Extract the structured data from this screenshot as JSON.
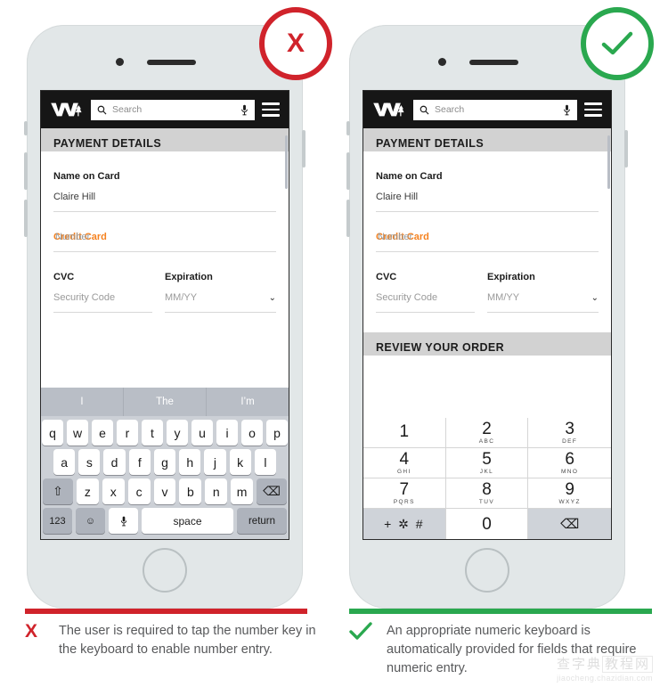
{
  "badges": {
    "bad": {
      "name": "x-mark",
      "glyph": "X",
      "color": "#d0232b"
    },
    "good": {
      "name": "check-mark",
      "glyph": "✓",
      "color": "#2aa84f"
    }
  },
  "appbar": {
    "logo_alt": "M logo",
    "search_placeholder": "Search",
    "search_icon": "search-icon",
    "mic_icon": "microphone-icon",
    "menu_icon": "hamburger-menu-icon"
  },
  "screen_left": {
    "section_title": "PAYMENT DETAILS",
    "fields": {
      "name_label": "Name on Card",
      "name_value": "Claire Hill",
      "card_label": "Credit Card",
      "card_placeholder": "Number",
      "cvc_label": "CVC",
      "cvc_placeholder": "Security  Code",
      "exp_label": "Expiration",
      "exp_placeholder": "MM/YY",
      "exp_chevron": "⌄"
    }
  },
  "screen_right": {
    "section_title": "PAYMENT DETAILS",
    "review_title": "REVIEW YOUR ORDER",
    "fields": {
      "name_label": "Name on Card",
      "name_value": "Claire Hill",
      "card_label": "Credit Card",
      "card_placeholder": "Number",
      "cvc_label": "CVC",
      "cvc_placeholder": "Security  Code",
      "exp_label": "Expiration",
      "exp_placeholder": "MM/YY",
      "exp_chevron": "⌄"
    }
  },
  "keyboard_alpha": {
    "suggestions": [
      "I",
      "The",
      "I’m"
    ],
    "row1": [
      "q",
      "w",
      "e",
      "r",
      "t",
      "y",
      "u",
      "i",
      "o",
      "p"
    ],
    "row2": [
      "a",
      "s",
      "d",
      "f",
      "g",
      "h",
      "j",
      "k",
      "l"
    ],
    "row3": [
      "z",
      "x",
      "c",
      "v",
      "b",
      "n",
      "m"
    ],
    "shift_key": "⇧",
    "backspace_key": "⌫",
    "numeric_key": "123",
    "emoji_key": "☺",
    "mic_key": "ᴷ",
    "space_key": "space",
    "return_key": "return"
  },
  "keyboard_numeric": {
    "keys": [
      {
        "digit": "1",
        "sub": ""
      },
      {
        "digit": "2",
        "sub": "ABC"
      },
      {
        "digit": "3",
        "sub": "DEF"
      },
      {
        "digit": "4",
        "sub": "GHI"
      },
      {
        "digit": "5",
        "sub": "JKL"
      },
      {
        "digit": "6",
        "sub": "MNO"
      },
      {
        "digit": "7",
        "sub": "PQRS"
      },
      {
        "digit": "8",
        "sub": "TUV"
      },
      {
        "digit": "9",
        "sub": "WXYZ"
      }
    ],
    "symbol_key": "+ ✲ #",
    "zero_key": "0",
    "backspace_key": "⌫"
  },
  "captions": {
    "left": {
      "symbol": "X",
      "text": "The user is required to tap the number key in the keyboard to enable number entry."
    },
    "right": {
      "symbol": "✓",
      "text": "An appropriate numeric keyboard is automatically provided for fields that require numeric entry."
    }
  },
  "watermark": {
    "cn_left": "查字典",
    "cn_right": "教程网",
    "en": "jiaocheng.chazidian.com"
  }
}
